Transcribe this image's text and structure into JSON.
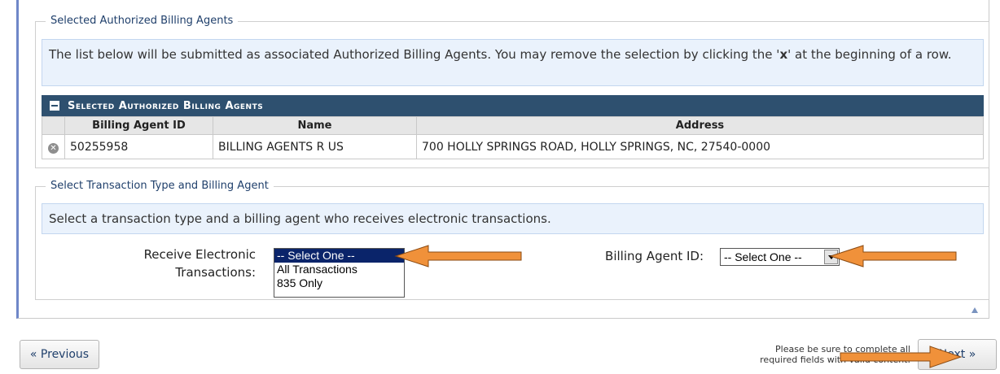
{
  "selected_section": {
    "legend": "Selected Authorized Billing Agents",
    "info_prefix": "The list below will be submitted as associated Authorized Billing Agents. You may remove the selection by clicking the '",
    "info_bold": "x",
    "info_suffix": "' at the beginning of a row.",
    "table_title": "Selected Authorized Billing Agents",
    "columns": [
      "Billing Agent ID",
      "Name",
      "Address"
    ],
    "rows": [
      {
        "id": "50255958",
        "name": "BILLING AGENTS R US",
        "address": "700 HOLLY SPRINGS ROAD, HOLLY SPRINGS, NC, 27540-0000"
      }
    ]
  },
  "transaction_section": {
    "legend": "Select Transaction Type and Billing Agent",
    "info": "Select a transaction type and a billing agent who receives electronic transactions.",
    "receive_label_line1": "Receive Electronic",
    "receive_label_line2": "Transactions:",
    "receive_options": [
      "-- Select One --",
      "All Transactions",
      "835 Only"
    ],
    "receive_selected": "-- Select One --",
    "billing_agent_label": "Billing Agent ID:",
    "billing_agent_value": "-- Select One --"
  },
  "footer": {
    "previous_label": "« Previous",
    "next_label": "Next »",
    "note_line1": "Please be sure to complete all",
    "note_line2": "required fields with valid content."
  },
  "colors": {
    "table_header": "#2e506f",
    "info_bg": "#eaf2fc",
    "arrow": "#f0913a",
    "selected_option": "#0a246a"
  },
  "icons": [
    "remove-row-icon",
    "collapse-icon",
    "dropdown-arrow-icon",
    "back-to-top-icon"
  ]
}
